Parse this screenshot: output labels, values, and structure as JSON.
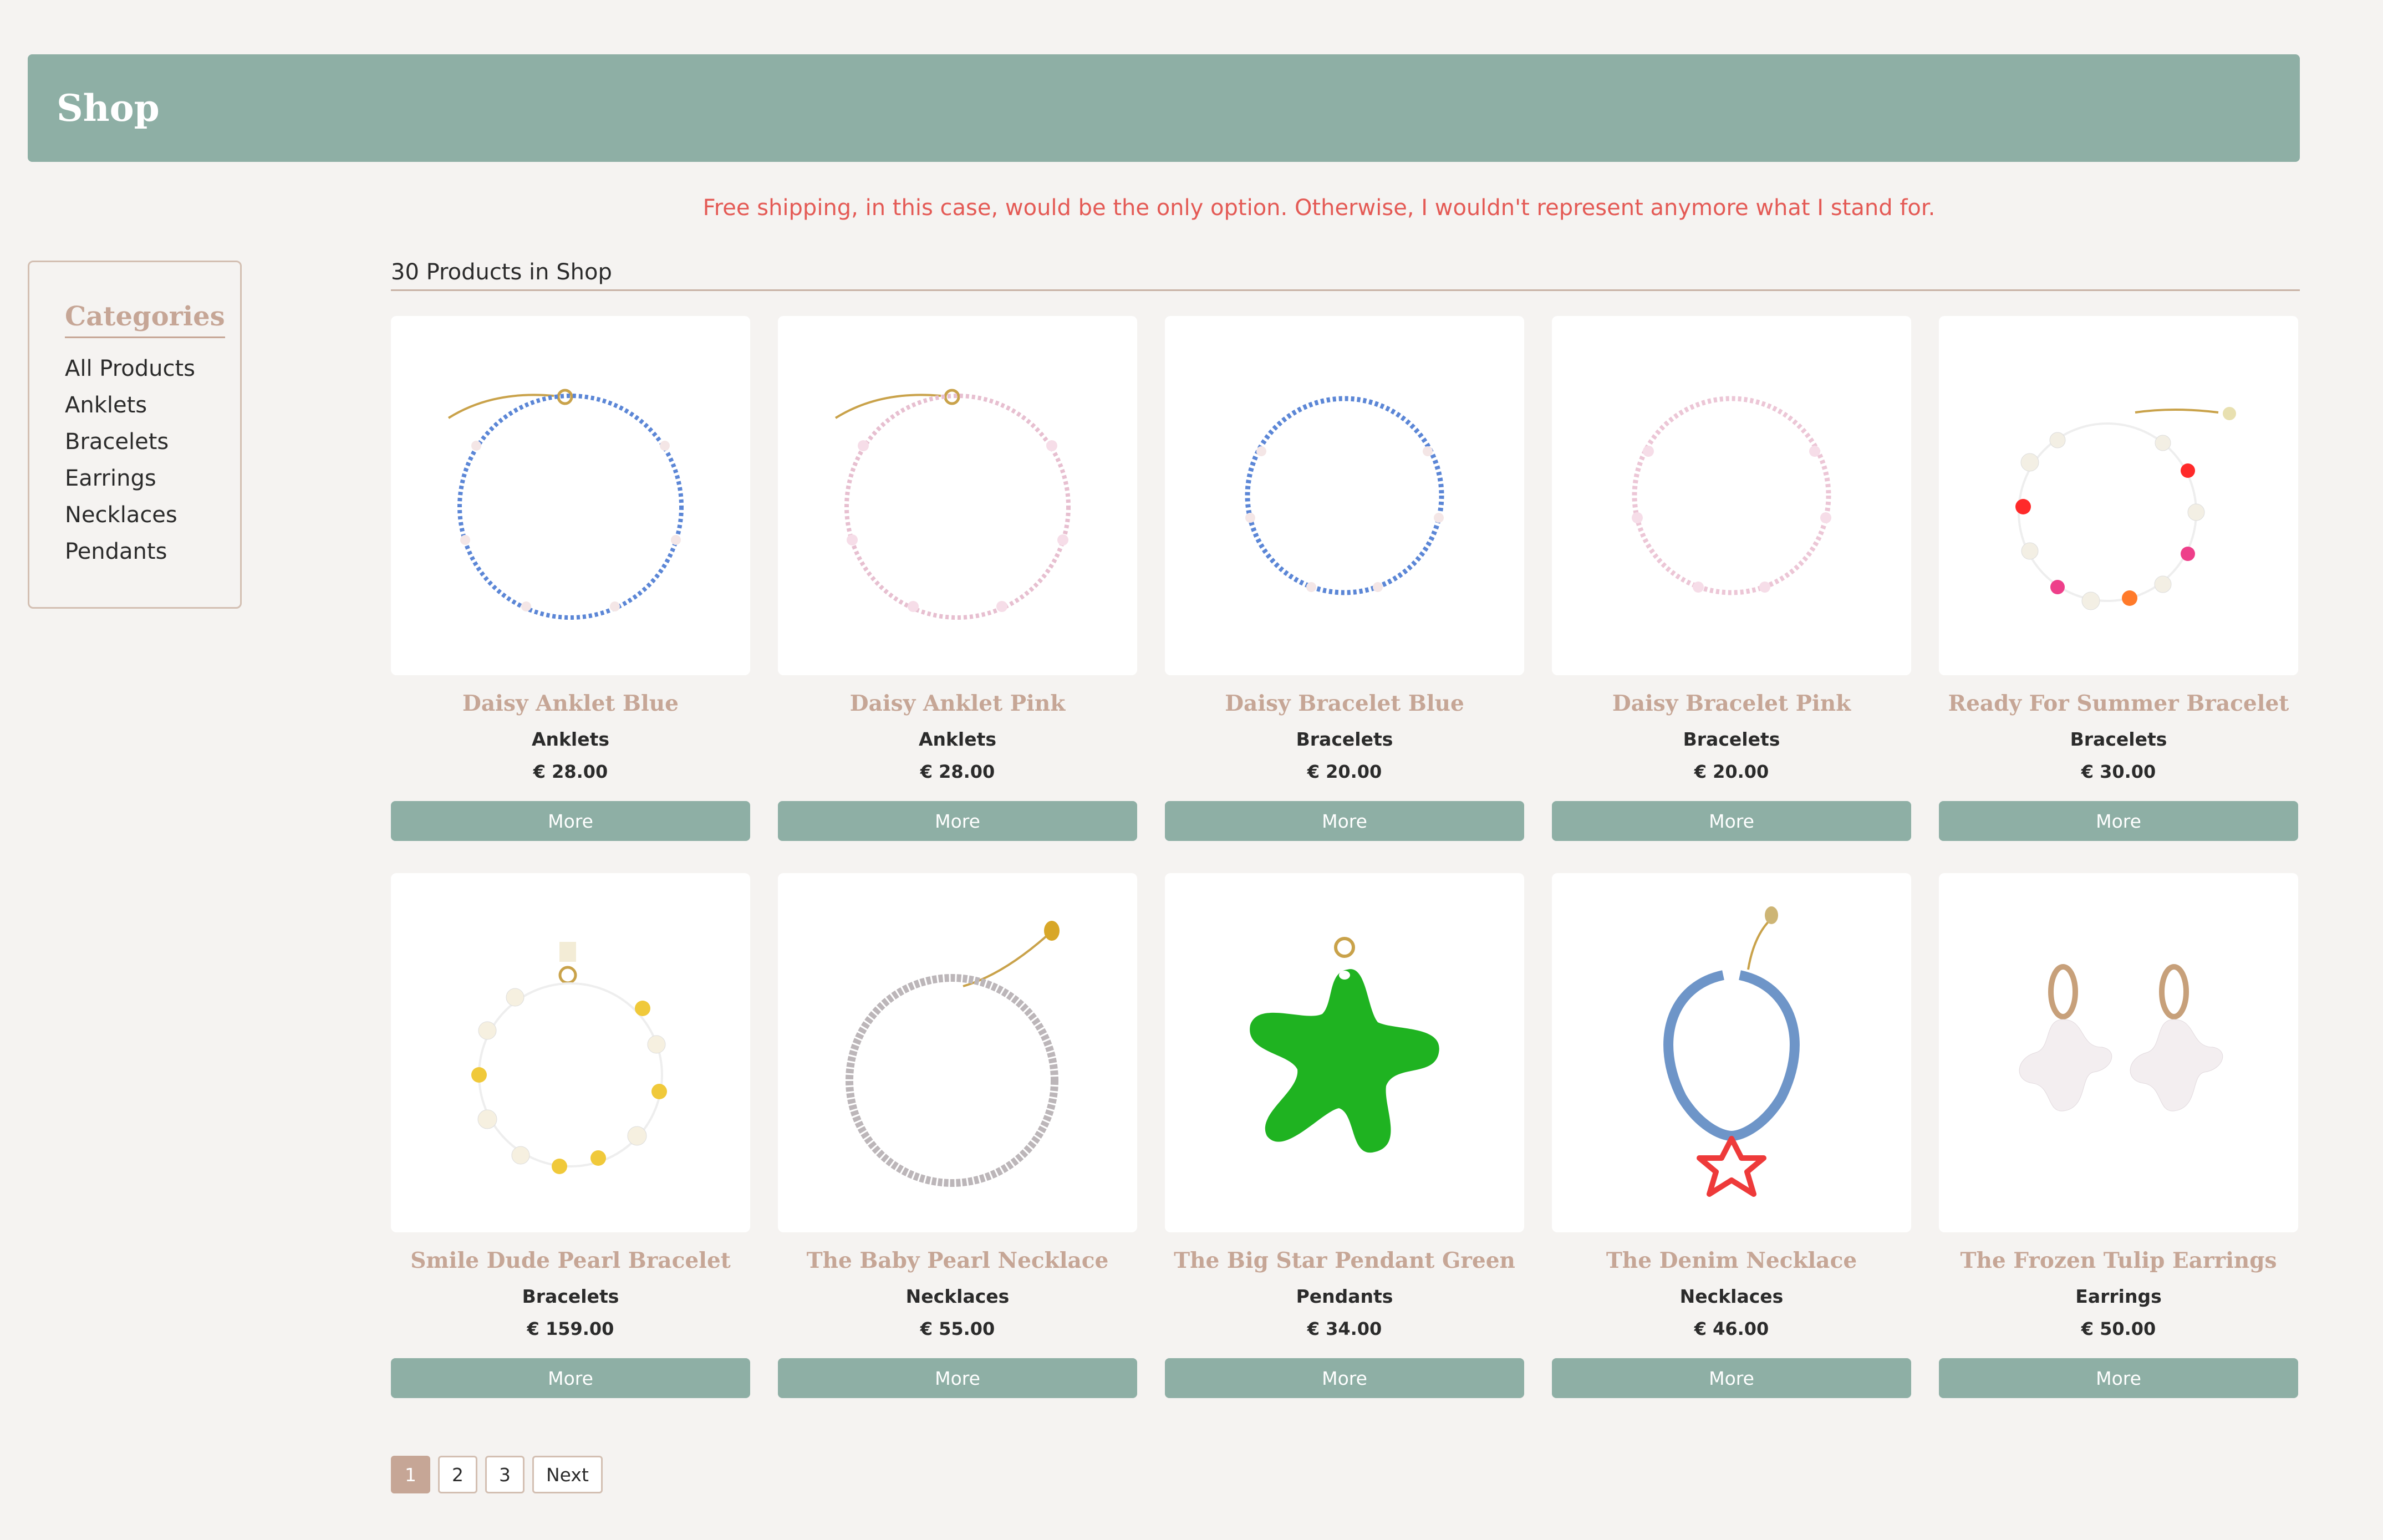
{
  "header": {
    "title": "Shop"
  },
  "notice": "Free shipping, in this case, would be the only option. Otherwise, I wouldn't represent anymore what I stand for.",
  "sidebar": {
    "title": "Categories",
    "items": [
      "All Products",
      "Anklets",
      "Bracelets",
      "Earrings",
      "Necklaces",
      "Pendants"
    ]
  },
  "products_count": "30 Products in Shop",
  "products": [
    {
      "name": "Daisy Anklet Blue",
      "category": "Anklets",
      "price": "€ 28.00",
      "button": "More",
      "image": "beaded-chain-blue"
    },
    {
      "name": "Daisy Anklet Pink",
      "category": "Anklets",
      "price": "€ 28.00",
      "button": "More",
      "image": "beaded-chain-pink"
    },
    {
      "name": "Daisy Bracelet Blue",
      "category": "Bracelets",
      "price": "€ 20.00",
      "button": "More",
      "image": "beaded-ring-blue"
    },
    {
      "name": "Daisy Bracelet Pink",
      "category": "Bracelets",
      "price": "€ 20.00",
      "button": "More",
      "image": "beaded-ring-pink"
    },
    {
      "name": "Ready For Summer Bracelet",
      "category": "Bracelets",
      "price": "€ 30.00",
      "button": "More",
      "image": "pearl-red-bracelet"
    },
    {
      "name": "Smile Dude Pearl Bracelet",
      "category": "Bracelets",
      "price": "€ 159.00",
      "button": "More",
      "image": "pearl-smiley-bracelet"
    },
    {
      "name": "The Baby Pearl Necklace",
      "category": "Necklaces",
      "price": "€ 55.00",
      "button": "More",
      "image": "baby-pearl-necklace"
    },
    {
      "name": "The Big Star Pendant Green",
      "category": "Pendants",
      "price": "€ 34.00",
      "button": "More",
      "image": "green-star-pendant"
    },
    {
      "name": "The Denim Necklace",
      "category": "Necklaces",
      "price": "€ 46.00",
      "button": "More",
      "image": "denim-star-necklace"
    },
    {
      "name": "The Frozen Tulip Earrings",
      "category": "Earrings",
      "price": "€ 50.00",
      "button": "More",
      "image": "tulip-earrings"
    }
  ],
  "pagination": {
    "pages": [
      "1",
      "2",
      "3"
    ],
    "next": "Next",
    "current": "1"
  },
  "colors": {
    "accent": "#8eafa5",
    "brand": "#c6a696",
    "notice": "#e45a55",
    "background": "#f5f3f1"
  }
}
